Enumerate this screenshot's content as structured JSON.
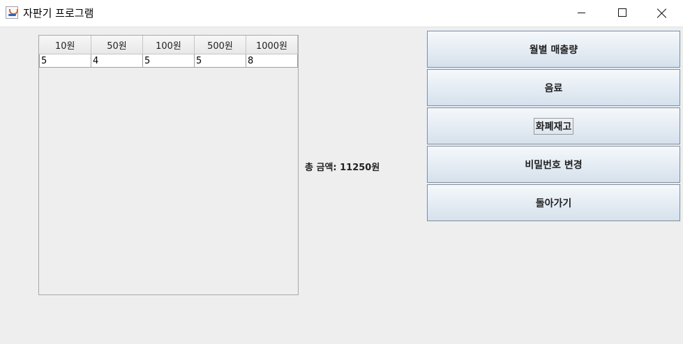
{
  "window": {
    "title": "자판기 프로그램"
  },
  "currency_table": {
    "headers": [
      "10원",
      "50원",
      "100원",
      "500원",
      "1000원"
    ],
    "values": [
      "5",
      "4",
      "5",
      "5",
      "8"
    ]
  },
  "total": {
    "label": "총 금액: 11250원"
  },
  "buttons": {
    "monthly_sales": "월별 매출량",
    "drinks": "음료",
    "currency_stock": "화폐재고",
    "change_password": "비밀번호 변경",
    "go_back": "돌아가기"
  }
}
